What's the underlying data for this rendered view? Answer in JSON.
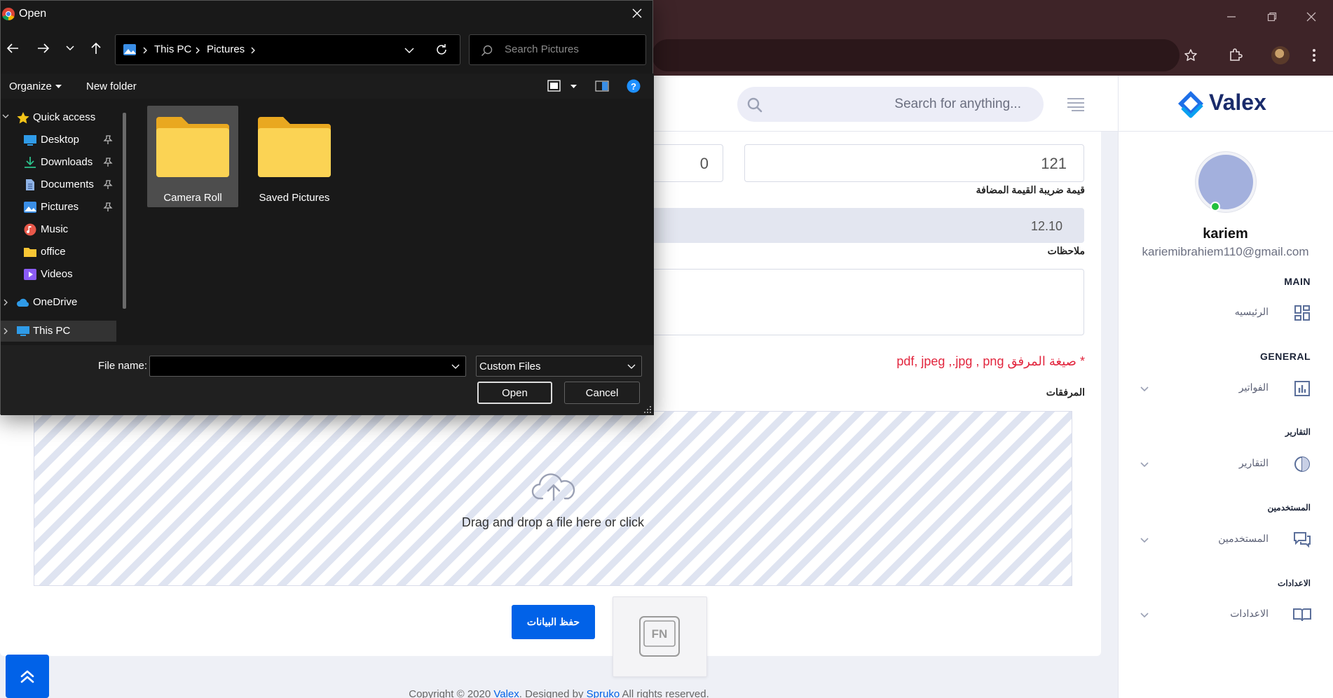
{
  "dialog": {
    "title": "Open",
    "address_crumbs": [
      "This PC",
      "Pictures"
    ],
    "search_placeholder": "Search Pictures",
    "organize_label": "Organize",
    "new_folder_label": "New folder",
    "nav": {
      "quick_access": "Quick access",
      "desktop": "Desktop",
      "downloads": "Downloads",
      "documents": "Documents",
      "pictures": "Pictures",
      "music": "Music",
      "office": "office",
      "videos": "Videos",
      "onedrive": "OneDrive",
      "this_pc": "This PC"
    },
    "folders": [
      "Camera Roll",
      "Saved Pictures"
    ],
    "file_name_label": "File name:",
    "file_name_value": "",
    "file_type_value": "Custom Files",
    "open_label": "Open",
    "cancel_label": "Cancel"
  },
  "page": {
    "search_placeholder": "Search for anything...",
    "field_left_value": "0",
    "field_right_value": "121",
    "vat_label": "قيمة ضريبة القيمة المضافة",
    "vat_value": "12.10",
    "notes_label": "ملاحظات",
    "notes_value": "",
    "accepted_formats": "صيغة المرفق pdf, jpeg ,.jpg , png",
    "accepted_star": "*",
    "attachments_label": "المرفقات",
    "dropzone_text": "Drag and drop a file here or click",
    "save_button": "حفظ البيانات",
    "fn_text": "FN",
    "footer": {
      "prefix": "Copyright © 2020 ",
      "brand": "Valex",
      "middle": ". Designed by ",
      "designer": "Spruko",
      "suffix": " All rights reserved."
    }
  },
  "sidebar": {
    "logo": "Valex",
    "user_name": "kariem",
    "user_email": "kariemibrahiem110@gmail.com",
    "sections": {
      "main": "MAIN",
      "general": "GENERAL",
      "reports": "التقارير",
      "users": "المستخدمين",
      "settings": "الاعدادات"
    },
    "items": {
      "home": "الرئيسيه",
      "invoices": "الفواتير",
      "reports": "التقارير",
      "users": "المستخدمين",
      "settings": "الاعدادات"
    }
  },
  "colors": {
    "accent": "#0162e8",
    "chrome_frame": "#3e2428",
    "dialog_bg": "#191919",
    "error_red": "#e2263e",
    "online_green": "#22c03c"
  }
}
